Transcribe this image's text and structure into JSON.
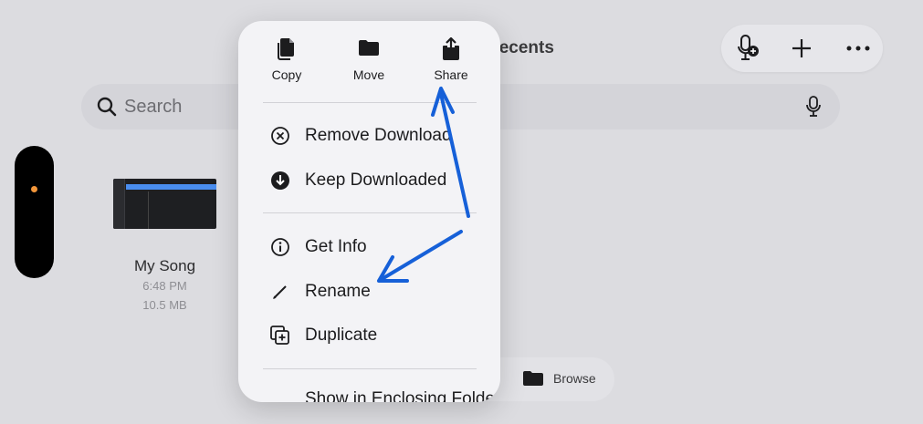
{
  "window": {
    "title": "Recents",
    "behind_title": "Browse"
  },
  "toolbar": {
    "icons": [
      "mic-plus-icon",
      "plus-icon",
      "more-icon"
    ]
  },
  "search": {
    "placeholder": "Search"
  },
  "file": {
    "name": "My Song",
    "time": "6:48 PM",
    "size": "10.5 MB"
  },
  "tabbar": {
    "browse_label": "Browse"
  },
  "menu": {
    "top_actions": [
      {
        "label": "Copy",
        "icon": "copy-icon"
      },
      {
        "label": "Move",
        "icon": "folder-icon"
      },
      {
        "label": "Share",
        "icon": "share-icon"
      }
    ],
    "group1": [
      {
        "label": "Remove Download",
        "icon": "x-circle-icon"
      },
      {
        "label": "Keep Downloaded",
        "icon": "download-circle-icon"
      }
    ],
    "group2": [
      {
        "label": "Get Info",
        "icon": "info-icon"
      },
      {
        "label": "Rename",
        "icon": "pencil-icon"
      },
      {
        "label": "Duplicate",
        "icon": "duplicate-icon"
      }
    ],
    "group3": [
      {
        "label": "Show in Enclosing Folder"
      }
    ]
  },
  "colors": {
    "accent": "#1660d8",
    "menu_bg": "#f3f3f6",
    "background": "#dcdce0",
    "dot": "#f2963a"
  }
}
